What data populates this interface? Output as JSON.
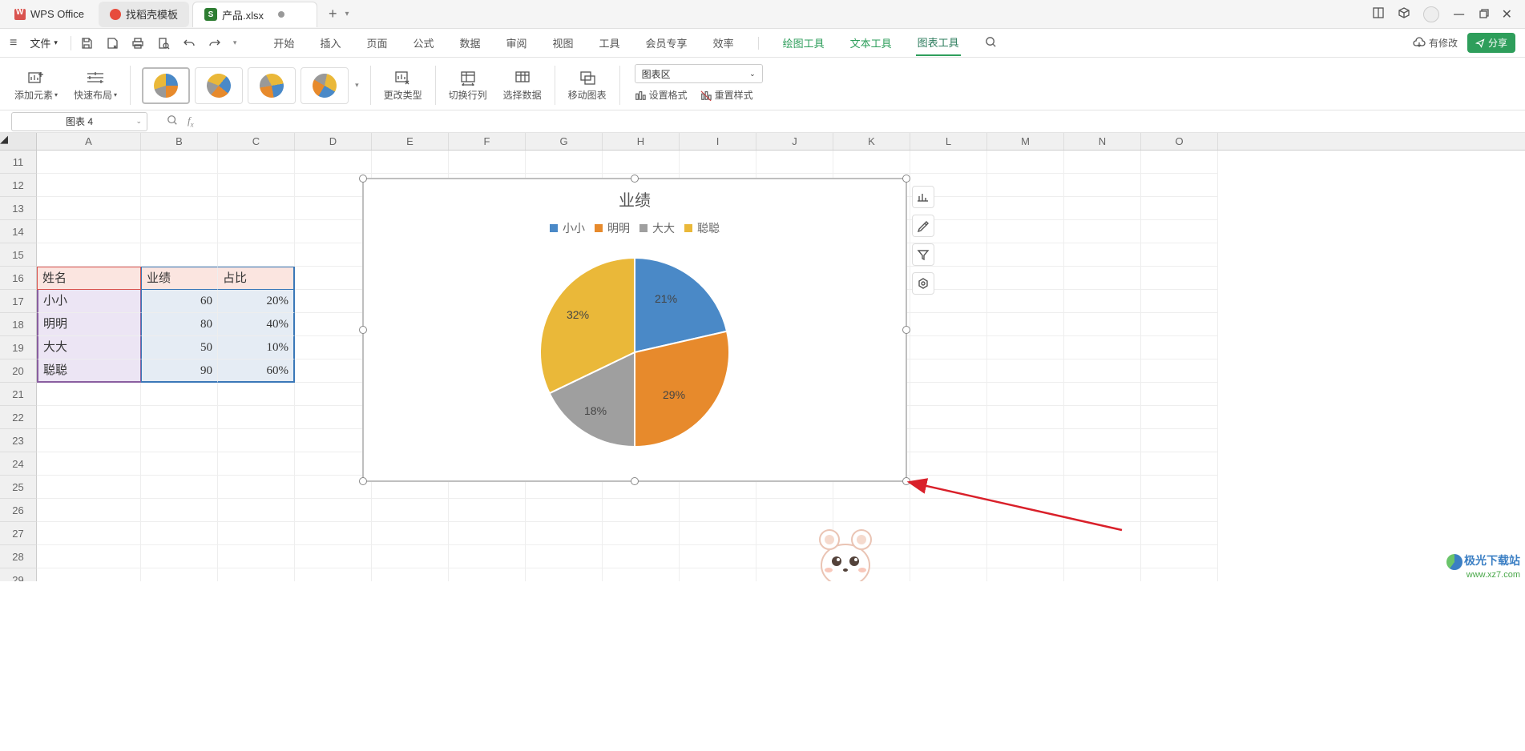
{
  "title_bar": {
    "tabs": [
      {
        "label": "WPS Office",
        "type": "home"
      },
      {
        "label": "找稻壳模板",
        "type": "template"
      },
      {
        "label": "产品.xlsx",
        "type": "active"
      }
    ]
  },
  "menu": {
    "file": "文件",
    "items": [
      "开始",
      "插入",
      "页面",
      "公式",
      "数据",
      "审阅",
      "视图",
      "工具",
      "会员专享",
      "效率"
    ],
    "context_items": [
      "绘图工具",
      "文本工具",
      "图表工具"
    ],
    "active": "图表工具",
    "cloud": "有修改",
    "share": "分享"
  },
  "ribbon": {
    "add_element": "添加元素",
    "quick_layout": "快速布局",
    "change_type": "更改类型",
    "switch_rc": "切换行列",
    "select_data": "选择数据",
    "move_chart": "移动图表",
    "chart_area_sel": "图表区",
    "set_format": "设置格式",
    "reset_style": "重置样式"
  },
  "namebox": "图表 4",
  "sheet": {
    "cols": [
      "A",
      "B",
      "C",
      "D",
      "E",
      "F",
      "G",
      "H",
      "I",
      "J",
      "K",
      "L",
      "M",
      "N",
      "O"
    ],
    "row_start": 11,
    "row_end": 29,
    "headers": {
      "a": "姓名",
      "b": "业绩",
      "c": "占比"
    },
    "data": [
      {
        "name": "小小",
        "perf": "60",
        "ratio": "20%"
      },
      {
        "name": "明明",
        "perf": "80",
        "ratio": "40%"
      },
      {
        "name": "大大",
        "perf": "50",
        "ratio": "10%"
      },
      {
        "name": "聪聪",
        "perf": "90",
        "ratio": "60%"
      }
    ]
  },
  "chart_data": {
    "type": "pie",
    "title": "业绩",
    "series_name": "业绩",
    "categories": [
      "小小",
      "明明",
      "大大",
      "聪聪"
    ],
    "values": [
      60,
      80,
      50,
      90
    ],
    "data_labels_pct": [
      "21%",
      "29%",
      "18%",
      "32%"
    ],
    "colors": [
      "#4a89c7",
      "#e78a2c",
      "#9f9f9f",
      "#eab839"
    ],
    "legend_position": "top"
  },
  "watermark": {
    "cn": "极光下载站",
    "url": "www.xz7.com"
  }
}
